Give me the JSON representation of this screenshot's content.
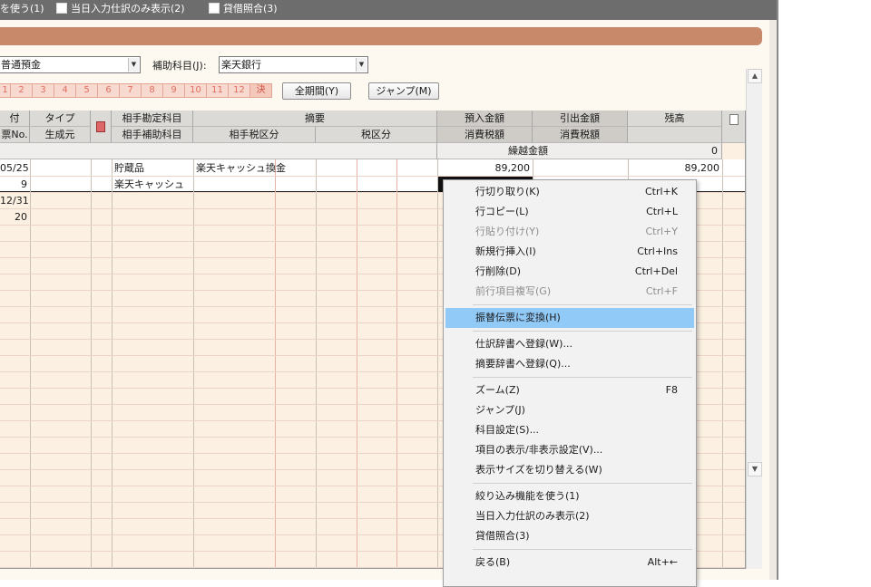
{
  "toolbar": {
    "option1": "を使う(1)",
    "option2": "当日入力仕訳のみ表示(2)",
    "option3": "貸借照合(3)"
  },
  "fields": {
    "account_value": "普通預金",
    "sub_label": "補助科目(J):",
    "sub_value": "楽天銀行"
  },
  "months": [
    "1",
    "2",
    "3",
    "4",
    "5",
    "6",
    "7",
    "8",
    "9",
    "10",
    "11",
    "12",
    "決"
  ],
  "buttons": {
    "all_period": "全期間(Y)",
    "jump": "ジャンプ(M)"
  },
  "headers": {
    "date": "付",
    "voucher": "票No.",
    "type": "タイプ",
    "origin": "生成元",
    "counter_account": "相手勘定科目",
    "counter_sub": "相手補助科目",
    "summary": "摘要",
    "counter_tax": "相手税区分",
    "tax": "税区分",
    "deposit": "預入金額",
    "deposit_tax": "消費税額",
    "withdraw": "引出金額",
    "withdraw_tax": "消費税額",
    "balance": "残高",
    "carryover_label": "繰越金額",
    "carryover_value": "0"
  },
  "rows": [
    {
      "date": "05/25",
      "voucher": "9",
      "account": "貯蔵品",
      "sub": "楽天キャッシュ",
      "summary": "楽天キャッシュ換金",
      "deposit": "89,200",
      "balance": "89,200"
    },
    {
      "date": "12/31",
      "voucher": "20"
    }
  ],
  "context_menu": {
    "items": [
      {
        "label": "行切り取り(K)",
        "shortcut": "Ctrl+K",
        "enabled": true
      },
      {
        "label": "行コピー(L)",
        "shortcut": "Ctrl+L",
        "enabled": true
      },
      {
        "label": "行貼り付け(Y)",
        "shortcut": "Ctrl+Y",
        "enabled": false
      },
      {
        "label": "新規行挿入(I)",
        "shortcut": "Ctrl+Ins",
        "enabled": true
      },
      {
        "label": "行削除(D)",
        "shortcut": "Ctrl+Del",
        "enabled": true
      },
      {
        "label": "前行項目複写(G)",
        "shortcut": "Ctrl+F",
        "enabled": false
      },
      {
        "label": "振替伝票に変換(H)",
        "shortcut": "",
        "enabled": true,
        "selected": true
      },
      {
        "label": "仕訳辞書へ登録(W)...",
        "shortcut": "",
        "enabled": true
      },
      {
        "label": "摘要辞書へ登録(Q)...",
        "shortcut": "",
        "enabled": true
      },
      {
        "label": "ズーム(Z)",
        "shortcut": "F8",
        "enabled": true
      },
      {
        "label": "ジャンプ(J)",
        "shortcut": "",
        "enabled": true
      },
      {
        "label": "科目設定(S)...",
        "shortcut": "",
        "enabled": true
      },
      {
        "label": "項目の表示/非表示設定(V)...",
        "shortcut": "",
        "enabled": true
      },
      {
        "label": "表示サイズを切り替える(W)",
        "shortcut": "",
        "enabled": true
      },
      {
        "label": "絞り込み機能を使う(1)",
        "shortcut": "",
        "enabled": true
      },
      {
        "label": "当日入力仕訳のみ表示(2)",
        "shortcut": "",
        "enabled": true
      },
      {
        "label": "貸借照合(3)",
        "shortcut": "",
        "enabled": true
      },
      {
        "label": "戻る(B)",
        "shortcut": "Alt+←",
        "enabled": true
      }
    ]
  },
  "colors": {
    "banner": "#c8896a",
    "menu_highlight": "#91c9f7",
    "grid_body": "#fbf0e1",
    "month_tab": "#f7d9cf"
  }
}
